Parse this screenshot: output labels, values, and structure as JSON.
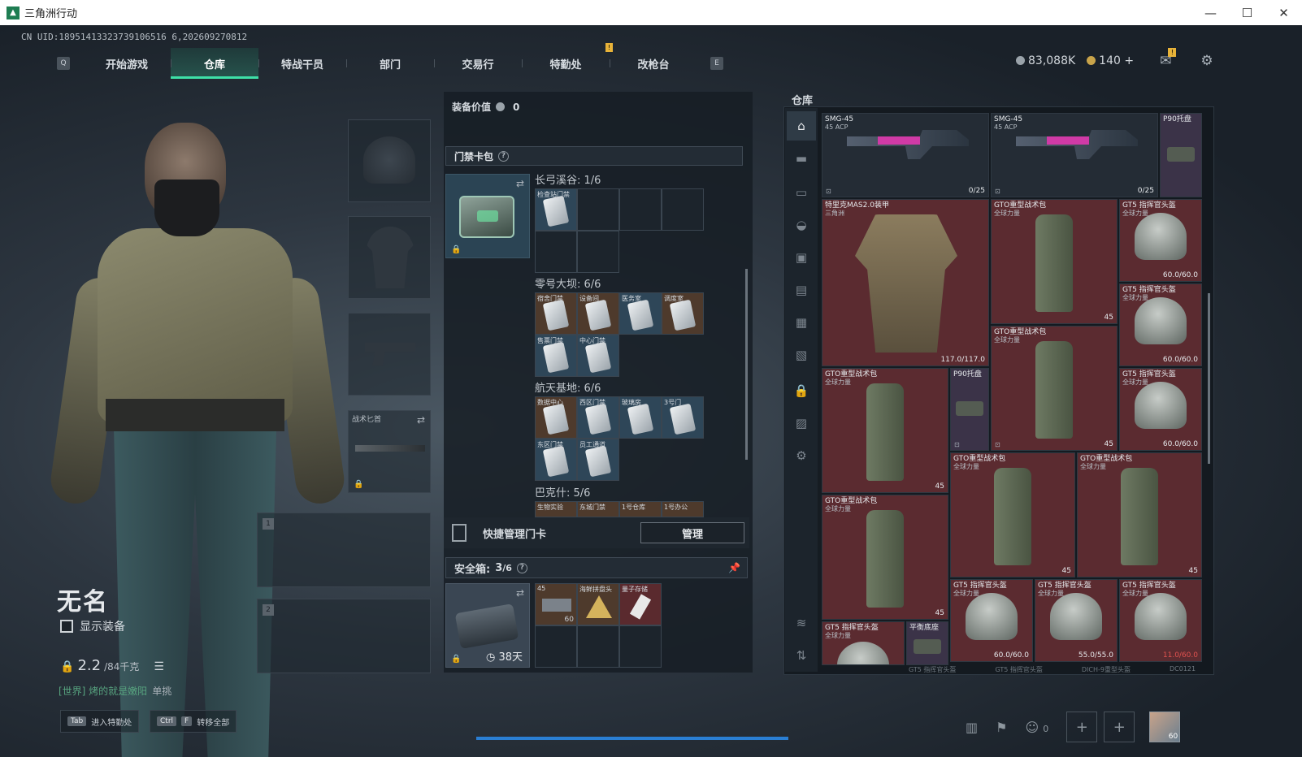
{
  "window": {
    "title": "三角洲行动",
    "minimize": "—",
    "maximize": "☐",
    "close": "✕"
  },
  "uid": "CN UID:18951413323739106516 6,202609270812",
  "nav": {
    "left_key": "Q",
    "right_key": "E",
    "tabs": [
      "开始游戏",
      "仓库",
      "特战干员",
      "部门",
      "交易行",
      "特勤处",
      "改枪台"
    ],
    "active_tab": "仓库",
    "alert_mark": "!"
  },
  "currency": {
    "silver": "83,088K",
    "gold": "140",
    "gold_plus": "+",
    "mail_badge": "!"
  },
  "equip_slots": {
    "knife_name": "战术匕首",
    "slot1_num": "1",
    "slot2_num": "2"
  },
  "character": {
    "name": "无名",
    "show_equipment": "显示装备",
    "weight_value": "2.2",
    "weight_unit": "/84千克"
  },
  "chat": {
    "channel": "[世界] 烤的就是嫩阳",
    "message": "单挑"
  },
  "hints": [
    {
      "key": "Tab",
      "label": "进入特勤处"
    },
    {
      "key": "Ctrl",
      "key2": "F",
      "label": "转移全部"
    }
  ],
  "middle": {
    "equip_value_label": "装备价值",
    "equip_value": "0",
    "keycard_title": "门禁卡包",
    "help": "?",
    "groups": [
      {
        "name": "长弓溪谷: 1/6",
        "cells": [
          "检查站门禁"
        ]
      },
      {
        "name": "零号大坝: 6/6",
        "cells": [
          "宿舍门禁",
          "设备间",
          "医务室",
          "调度室",
          "售票门禁",
          "中心门禁"
        ]
      },
      {
        "name": "航天基地: 6/6",
        "cells": [
          "数据中心",
          "西区门禁",
          "玻璃房",
          "3号门",
          "东区门禁",
          "员工通道"
        ]
      },
      {
        "name": "巴克什: 5/6",
        "cells": [
          "生物实验",
          "东城门禁",
          "1号仓库",
          "1号办公"
        ]
      }
    ],
    "quick_manage": "快捷管理门卡",
    "manage_button": "管理",
    "safebox_label": "安全箱: ",
    "safebox_count": "3",
    "safebox_total": "/6",
    "safebox_timer": "38天",
    "safebox_items": [
      {
        "name": "45",
        "count": "60"
      },
      {
        "name": "海鲜拼盘头"
      },
      {
        "name": "量子存储"
      }
    ]
  },
  "warehouse": {
    "title": "仓库",
    "items": [
      {
        "name": "SMG-45",
        "sub": "45 ACP",
        "value": "0/25",
        "type": "gun"
      },
      {
        "name": "SMG-45",
        "sub": "45 ACP",
        "value": "0/25",
        "type": "gun"
      },
      {
        "name": "P90托盘",
        "type": "small"
      },
      {
        "name": "特里克MAS2.0装甲",
        "sub": "三角洲",
        "value": "117.0/117.0",
        "type": "vest"
      },
      {
        "name": "GTO重型战术包",
        "sub": "全球力量",
        "value": "45",
        "type": "bag"
      },
      {
        "name": "GT5 指挥官头盔",
        "sub": "全球力量",
        "value": "60.0/60.0",
        "type": "helmet"
      },
      {
        "name": "GT5 指挥官头盔",
        "sub": "全球力量",
        "value": "60.0/60.0",
        "type": "helmet"
      },
      {
        "name": "GTO重型战术包",
        "sub": "全球力量",
        "value": "45",
        "type": "bag"
      },
      {
        "name": "GT5 指挥官头盔",
        "sub": "全球力量",
        "value": "60.0/60.0",
        "type": "helmet"
      },
      {
        "name": "GTO重型战术包",
        "sub": "全球力量",
        "value": "45",
        "type": "bag"
      },
      {
        "name": "P90托盘",
        "type": "small"
      },
      {
        "name": "GTO重型战术包",
        "sub": "全球力量",
        "value": "45",
        "type": "bag"
      },
      {
        "name": "GTO重型战术包",
        "sub": "全球力量",
        "value": "45",
        "type": "bag"
      },
      {
        "name": "GTO重型战术包",
        "sub": "全球力量",
        "value": "45",
        "type": "bag"
      },
      {
        "name": "GT5 指挥官头盔",
        "sub": "全球力量",
        "value": "60.0/60.0",
        "type": "helmet"
      },
      {
        "name": "GT5 指挥官头盔",
        "sub": "全球力量",
        "value": "55.0/55.0",
        "type": "helmet"
      },
      {
        "name": "GT5 指挥官头盔",
        "sub": "全球力量",
        "value": "11.0/60.0",
        "type": "helmet"
      },
      {
        "name": "GT5 指挥官头盔",
        "sub": "全球力量",
        "type": "helmet"
      },
      {
        "name": "平衡底座",
        "type": "small"
      }
    ],
    "bottom_row": [
      "GT5 指挥官头盔",
      "GT5 指挥官头盔",
      "DICH-9重型头盔",
      "DC0121"
    ]
  },
  "bottom": {
    "friends_count": "0",
    "avatar_level": "60"
  },
  "colors": {
    "accent": "#3ee0a7",
    "item_red": "#5b2b30",
    "progress_blue": "#2a7fd4"
  }
}
